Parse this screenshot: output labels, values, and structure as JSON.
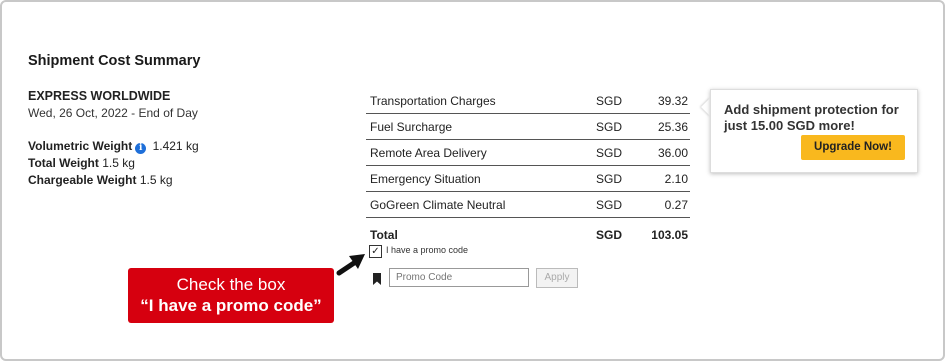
{
  "summary": {
    "title": "Shipment Cost Summary",
    "service": "EXPRESS WORLDWIDE",
    "date": "Wed, 26 Oct, 2022 - End of Day"
  },
  "weights": [
    {
      "label": "Volumetric Weight",
      "value": "1.421 kg",
      "has_info_icon": true
    },
    {
      "label": "Total Weight",
      "value": "1.5 kg",
      "has_info_icon": false
    },
    {
      "label": "Chargeable Weight",
      "value": "1.5 kg",
      "has_info_icon": false
    }
  ],
  "charges": [
    {
      "name": "Transportation Charges",
      "currency": "SGD",
      "amount": "39.32"
    },
    {
      "name": "Fuel Surcharge",
      "currency": "SGD",
      "amount": "25.36"
    },
    {
      "name": "Remote Area Delivery",
      "currency": "SGD",
      "amount": "36.00"
    },
    {
      "name": "Emergency Situation",
      "currency": "SGD",
      "amount": "2.10"
    },
    {
      "name": "GoGreen Climate Neutral",
      "currency": "SGD",
      "amount": "0.27"
    }
  ],
  "total": {
    "label": "Total",
    "currency": "SGD",
    "amount": "103.05"
  },
  "promo": {
    "checkbox_label": "I have a promo code",
    "checked": true,
    "input_placeholder": "Promo Code",
    "apply_label": "Apply"
  },
  "protection": {
    "text": "Add shipment protection for just 15.00 SGD more!",
    "button_label": "Upgrade Now!"
  },
  "callout": {
    "line1": "Check the box",
    "line2": "“I have a promo code”"
  },
  "colors": {
    "callout_bg": "#d6000f",
    "upgrade_bg": "#f9b81e",
    "info_icon": "#1e6fd9"
  }
}
